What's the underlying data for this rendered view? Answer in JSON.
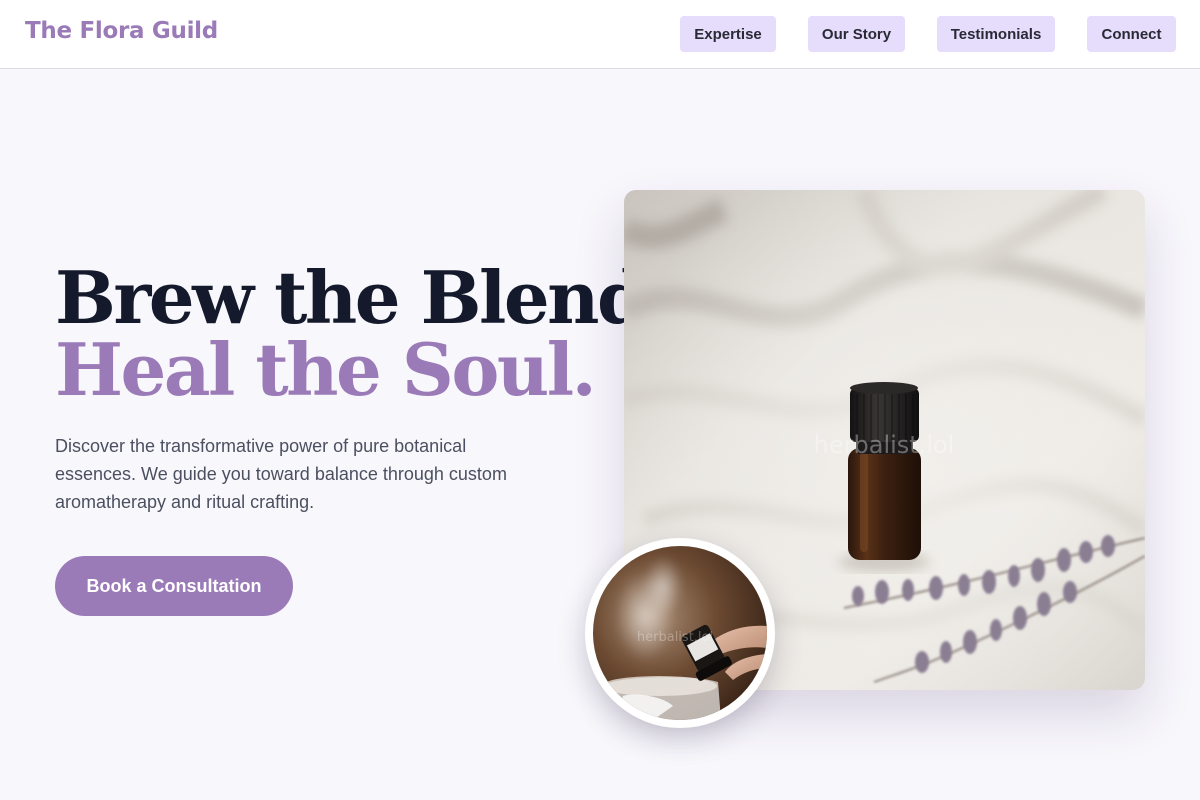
{
  "header": {
    "logo": "The Flora Guild",
    "nav": [
      "Expertise",
      "Our Story",
      "Testimonials",
      "Connect"
    ]
  },
  "hero": {
    "title_line1": "Brew the Blend,",
    "title_line2": "Heal the Soul.",
    "description": "Discover the transformative power of pure botanical essences. We guide you toward balance through custom aromatherapy and ritual crafting.",
    "cta_label": "Book a Consultation",
    "main_image_watermark": "herbalist.lol",
    "round_image_watermark": "herbalist.lol"
  },
  "colors": {
    "accent": "#9b7ab8",
    "nav_button_bg": "#e6dcfc",
    "heading_dark": "#141a2c",
    "page_bg": "#f8f7fc"
  }
}
